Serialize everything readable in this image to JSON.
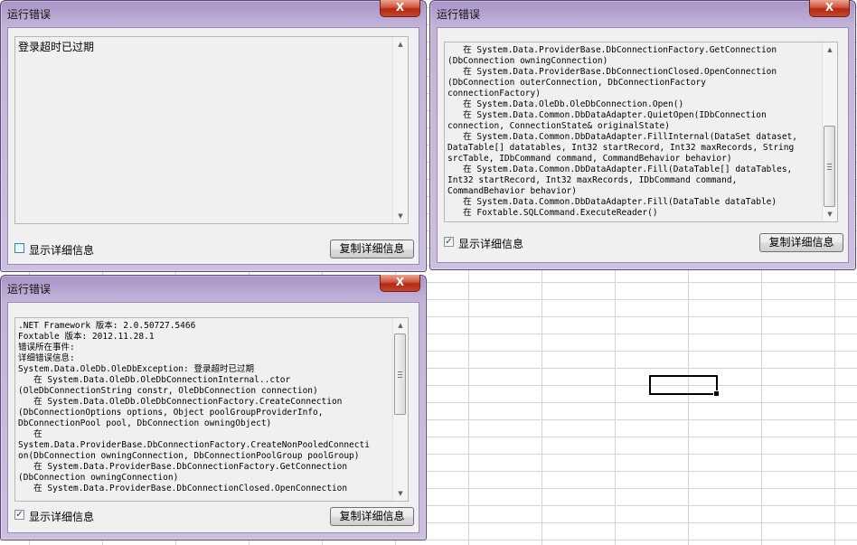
{
  "spreadsheet": {
    "name": "background-grid"
  },
  "dialogs": [
    {
      "title": "运行错误",
      "close_label": "X",
      "message": "登录超时已过期",
      "show_details_label": "显示详细信息",
      "show_details_checked": false,
      "copy_button_label": "复制详细信息"
    },
    {
      "title": "运行错误",
      "close_label": "X",
      "message": "   在 System.Data.ProviderBase.DbConnectionFactory.GetConnection\n(DbConnection owningConnection)\n   在 System.Data.ProviderBase.DbConnectionClosed.OpenConnection\n(DbConnection outerConnection, DbConnectionFactory\nconnectionFactory)\n   在 System.Data.OleDb.OleDbConnection.Open()\n   在 System.Data.Common.DbDataAdapter.QuietOpen(IDbConnection\nconnection, ConnectionState& originalState)\n   在 System.Data.Common.DbDataAdapter.FillInternal(DataSet dataset,\nDataTable[] datatables, Int32 startRecord, Int32 maxRecords, String\nsrcTable, IDbCommand command, CommandBehavior behavior)\n   在 System.Data.Common.DbDataAdapter.Fill(DataTable[] dataTables,\nInt32 startRecord, Int32 maxRecords, IDbCommand command,\nCommandBehavior behavior)\n   在 System.Data.Common.DbDataAdapter.Fill(DataTable dataTable)\n   在 Foxtable.SQLCommand.ExecuteReader()",
      "show_details_label": "显示详细信息",
      "show_details_checked": true,
      "copy_button_label": "复制详细信息"
    },
    {
      "title": "运行错误",
      "close_label": "X",
      "message": ".NET Framework 版本: 2.0.50727.5466\nFoxtable 版本: 2012.11.28.1\n错误所在事件:\n详细错误信息:\nSystem.Data.OleDb.OleDbException: 登录超时已过期\n   在 System.Data.OleDb.OleDbConnectionInternal..ctor\n(OleDbConnectionString constr, OleDbConnection connection)\n   在 System.Data.OleDb.OleDbConnectionFactory.CreateConnection\n(DbConnectionOptions options, Object poolGroupProviderInfo,\nDbConnectionPool pool, DbConnection owningObject)\n   在\nSystem.Data.ProviderBase.DbConnectionFactory.CreateNonPooledConnecti\non(DbConnection owningConnection, DbConnectionPoolGroup poolGroup)\n   在 System.Data.ProviderBase.DbConnectionFactory.GetConnection\n(DbConnection owningConnection)\n   在 System.Data.ProviderBase.DbConnectionClosed.OpenConnection",
      "show_details_label": "显示详细信息",
      "show_details_checked": true,
      "copy_button_label": "复制详细信息"
    }
  ],
  "check_glyph": "✓",
  "colors": {
    "title_bar": "#a993c6",
    "close_button": "#c7452c",
    "client_bg": "#f0f0f0"
  }
}
